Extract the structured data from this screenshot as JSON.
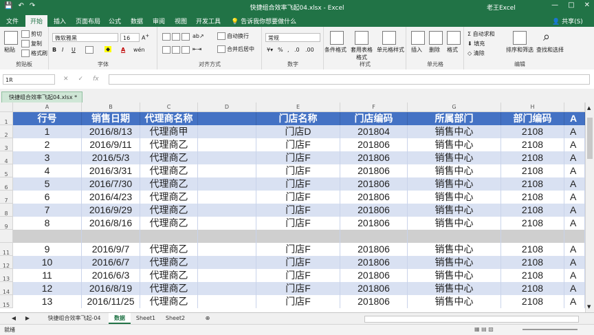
{
  "title_bar": {
    "doc_title": "快捷组合效率飞起04.xlsx  -  Excel",
    "user": "老王Excel",
    "quick_access": [
      "💾",
      "↶",
      "↷"
    ],
    "window_controls": [
      "—",
      "□",
      "✕"
    ]
  },
  "ribbon_tabs": {
    "items": [
      "文件",
      "开始",
      "插入",
      "页面布局",
      "公式",
      "数据",
      "审阅",
      "视图",
      "开发工具"
    ],
    "active": "开始",
    "tell_me": "告诉我你想要做什么",
    "share": "共享(S)"
  },
  "ribbon": {
    "clipboard": {
      "label": "剪贴板",
      "paste": "粘贴",
      "cut": "剪切",
      "copy": "复制",
      "format_painter": "格式刷"
    },
    "font": {
      "label": "字体",
      "name": "微软雅黑",
      "size": "16",
      "bold": "B",
      "italic": "I",
      "underline": "U",
      "font_color": "A",
      "wen": "wén"
    },
    "alignment": {
      "label": "对齐方式",
      "wrap": "自动换行",
      "merge": "合并后居中"
    },
    "number": {
      "label": "数字",
      "format": "常规",
      "percent": "%",
      "comma": ",",
      "inc": ".0",
      "dec": ".00"
    },
    "styles": {
      "label": "样式",
      "cond": "条件格式",
      "table": "套用表格格式",
      "cell": "单元格样式"
    },
    "cells": {
      "label": "单元格",
      "insert": "插入",
      "delete": "删除",
      "format": "格式"
    },
    "editing": {
      "label": "编辑",
      "autosum": "自动求和",
      "fill": "填充",
      "clear": "清除",
      "sort": "排序和筛选",
      "find": "查找和选择"
    }
  },
  "formula_bar": {
    "name_box": "1R",
    "cancel": "✕",
    "enter": "✓",
    "fx": "fx",
    "value": ""
  },
  "workbook_tab": "快捷组合效率飞起04.xlsx *",
  "columns": [
    "A",
    "B",
    "C",
    "D",
    "E",
    "F",
    "G",
    "H"
  ],
  "header_row": {
    "row_num": "1",
    "cells": [
      "行号",
      "销售日期",
      "代理商名称",
      "",
      "门店名称",
      "门店编码",
      "所属部门",
      "部门编码",
      "A"
    ]
  },
  "rows": [
    {
      "row_num": "2",
      "cells": [
        "1",
        "2016/8/13",
        "代理商甲",
        "",
        "门店D",
        "201804",
        "销售中心",
        "2108",
        "A"
      ]
    },
    {
      "row_num": "3",
      "cells": [
        "2",
        "2016/9/11",
        "代理商乙",
        "",
        "门店F",
        "201806",
        "销售中心",
        "2108",
        "A"
      ]
    },
    {
      "row_num": "4",
      "cells": [
        "3",
        "2016/5/3",
        "代理商乙",
        "",
        "门店F",
        "201806",
        "销售中心",
        "2108",
        "A"
      ]
    },
    {
      "row_num": "5",
      "cells": [
        "4",
        "2016/3/31",
        "代理商乙",
        "",
        "门店F",
        "201806",
        "销售中心",
        "2108",
        "A"
      ]
    },
    {
      "row_num": "6",
      "cells": [
        "5",
        "2016/7/30",
        "代理商乙",
        "",
        "门店F",
        "201806",
        "销售中心",
        "2108",
        "A"
      ]
    },
    {
      "row_num": "7",
      "cells": [
        "6",
        "2016/4/23",
        "代理商乙",
        "",
        "门店F",
        "201806",
        "销售中心",
        "2108",
        "A"
      ]
    },
    {
      "row_num": "8",
      "cells": [
        "7",
        "2016/9/29",
        "代理商乙",
        "",
        "门店F",
        "201806",
        "销售中心",
        "2108",
        "A"
      ]
    },
    {
      "row_num": "9",
      "cells": [
        "8",
        "2016/8/16",
        "代理商乙",
        "",
        "门店F",
        "201806",
        "销售中心",
        "2108",
        "A"
      ]
    },
    {
      "row_num": "",
      "cells": [
        "",
        "",
        "",
        "",
        "",
        "",
        "",
        "",
        ""
      ]
    },
    {
      "row_num": "11",
      "cells": [
        "9",
        "2016/9/7",
        "代理商乙",
        "",
        "门店F",
        "201806",
        "销售中心",
        "2108",
        "A"
      ]
    },
    {
      "row_num": "12",
      "cells": [
        "10",
        "2016/6/7",
        "代理商乙",
        "",
        "门店F",
        "201806",
        "销售中心",
        "2108",
        "A"
      ]
    },
    {
      "row_num": "13",
      "cells": [
        "11",
        "2016/6/3",
        "代理商乙",
        "",
        "门店F",
        "201806",
        "销售中心",
        "2108",
        "A"
      ]
    },
    {
      "row_num": "14",
      "cells": [
        "12",
        "2016/8/19",
        "代理商乙",
        "",
        "门店F",
        "201806",
        "销售中心",
        "2108",
        "A"
      ]
    },
    {
      "row_num": "15",
      "cells": [
        "13",
        "2016/11/25",
        "代理商乙",
        "",
        "门店F",
        "201806",
        "销售中心",
        "2108",
        "A"
      ]
    }
  ],
  "sheet_tabs": {
    "items": [
      "快捷组合效率飞起-04",
      "数据",
      "Sheet1",
      "Sheet2"
    ],
    "active": "数据",
    "add": "⊕"
  },
  "status_bar": {
    "ready": "就绪"
  },
  "colors": {
    "excel_green": "#217346",
    "header_blue": "#4472c4",
    "band_blue": "#d9e1f2"
  }
}
